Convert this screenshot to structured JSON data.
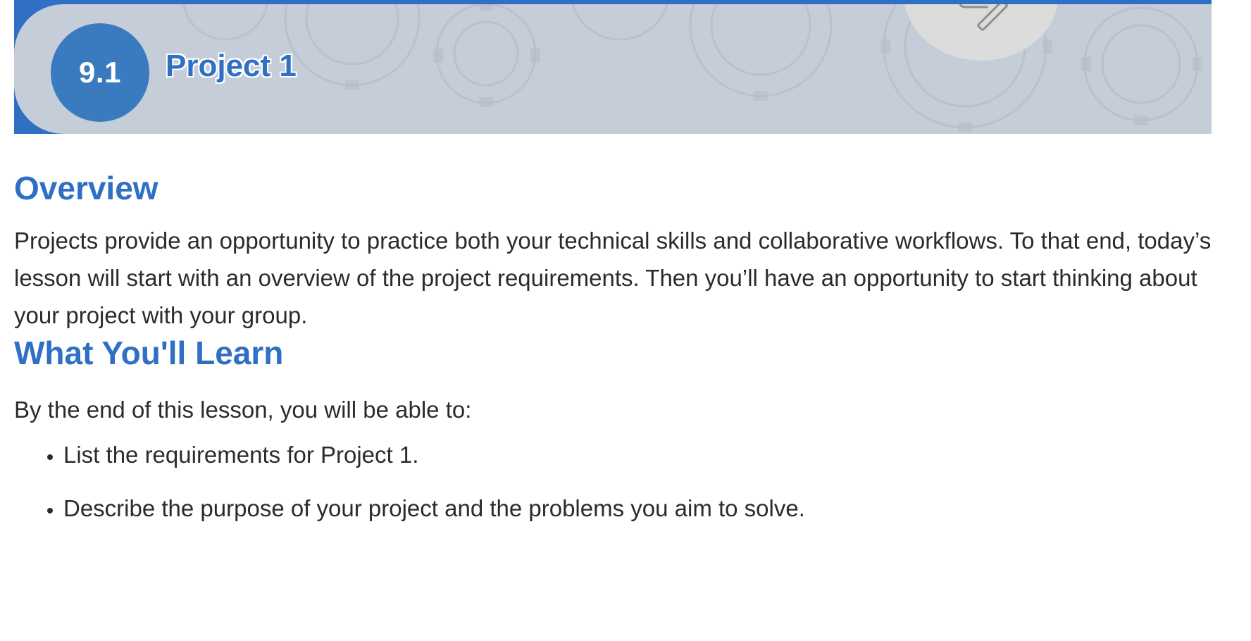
{
  "banner": {
    "lesson_number": "9.1",
    "lesson_title": "Project 1",
    "colors": {
      "accent": "#2f6fc4",
      "badge": "#3a7bc0",
      "panel": "#c5cdd8"
    },
    "decorations": [
      "gear-icon",
      "wrench-icon"
    ]
  },
  "overview": {
    "heading": "Overview",
    "text": "Projects provide an opportunity to practice both your technical skills and collaborative workflows. To that end, today’s lesson will start with an overview of the project requirements. Then you’ll have an opportunity to start thinking about your project with your group."
  },
  "learn": {
    "heading": "What You'll Learn",
    "intro": "By the end of this lesson, you will be able to:",
    "objectives": [
      "List the requirements for Project 1.",
      "Describe the purpose of your project and the problems you aim to solve."
    ]
  }
}
